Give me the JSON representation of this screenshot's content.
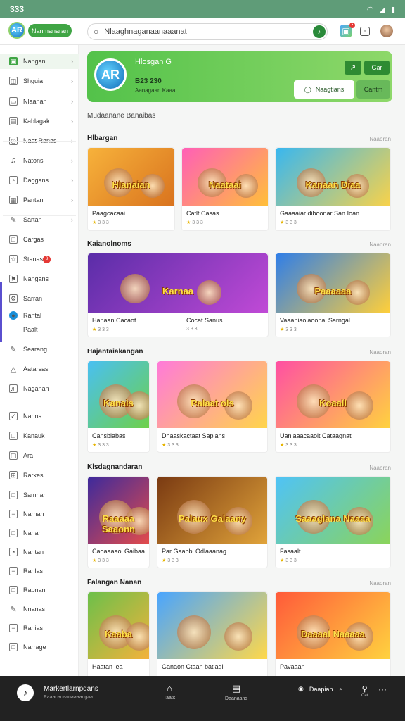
{
  "status": {
    "time": "333"
  },
  "header": {
    "logo_glyph": "AR",
    "brand": "Nanmanaran",
    "search_placeholder": "Nlaaghnaganaanaaanat",
    "mic_glyph": "♪"
  },
  "sidebar": {
    "items": [
      {
        "label": "Nangan",
        "icon": "home-icon"
      },
      {
        "label": "Shguia",
        "icon": "shorts-icon"
      },
      {
        "label": "Nlaanan",
        "icon": "subscriptions-icon"
      },
      {
        "label": "Kablagak",
        "icon": "library-icon"
      },
      {
        "label": "Naat Ranas",
        "icon": "history-icon"
      },
      {
        "label": "Natons",
        "icon": "bell-icon"
      },
      {
        "label": "Daggans",
        "icon": "clock-icon"
      },
      {
        "label": "Pantan",
        "icon": "film-icon"
      },
      {
        "label": "Sartan",
        "icon": "pencil-icon"
      },
      {
        "label": "Cargas",
        "icon": "box-icon"
      },
      {
        "label": "Stanas",
        "icon": "star-icon",
        "badge": "3"
      },
      {
        "label": "Nangans",
        "icon": "flag-icon"
      },
      {
        "label": "Sarran",
        "icon": "gear-icon"
      },
      {
        "label": "Rantal",
        "icon": "globe-icon"
      },
      {
        "label": "Paalt",
        "icon": "none"
      },
      {
        "label": "Searang",
        "icon": "pencil-icon"
      },
      {
        "label": "Aatarsas",
        "icon": "triangle-icon"
      },
      {
        "label": "Naganan",
        "icon": "music-icon"
      },
      {
        "label": "Nanns",
        "icon": "check-icon"
      },
      {
        "label": "Kanauk",
        "icon": "box-icon"
      },
      {
        "label": "Ara",
        "icon": "ticket-icon"
      },
      {
        "label": "Rarkes",
        "icon": "cart-icon"
      },
      {
        "label": "Samnan",
        "icon": "box-icon"
      },
      {
        "label": "Narnan",
        "icon": "list-icon"
      },
      {
        "label": "Nanan",
        "icon": "box-icon"
      },
      {
        "label": "Nantan",
        "icon": "clock-icon"
      },
      {
        "label": "Ranlas",
        "icon": "list-icon"
      },
      {
        "label": "Rapnan",
        "icon": "box-icon"
      },
      {
        "label": "Nnanas",
        "icon": "pencil-icon"
      },
      {
        "label": "Ranias",
        "icon": "list-icon"
      },
      {
        "label": "Narrage",
        "icon": "box-icon"
      }
    ]
  },
  "hero": {
    "title": "Hlosgan G",
    "sub1": "B23 230",
    "sub2": "Aanagaan Kaaa",
    "follow": "Naagtians",
    "join": "Cantm",
    "btn_small": "↗",
    "btn_dark": "Gar"
  },
  "description": "Mudaanane Banaibas",
  "sections": [
    {
      "title": "Hlbargan",
      "more": "Naaoran",
      "cards": [
        {
          "name": "Paagcacaai",
          "meta": "3 3 3",
          "thumb_text": "Hlanaian"
        },
        {
          "name": "Catlt Casas",
          "meta": "3 3 3",
          "thumb_text": "Naataai"
        },
        {
          "name": "Gaaaaiar diboonar San Ioan",
          "meta": "3 3 3",
          "thumb_text": "Kanaan Diaa"
        }
      ]
    },
    {
      "title": "Kaianolnoms",
      "more": "Naaoran",
      "cards": [
        {
          "name": "Hanaan Cacaot",
          "meta": "3 3 3",
          "thumb_text": "Karnaa"
        },
        {
          "name": "Cocat Sanus",
          "meta": "3 3 3",
          "thumb_text": ""
        },
        {
          "name": "Vaaaniaolaoonal Sarngal",
          "meta": "3 3 3",
          "thumb_text": "Paaaaaa"
        }
      ]
    },
    {
      "title": "Hajantaiakangan",
      "more": "Naaoran",
      "cards": [
        {
          "name": "Cansblabas",
          "meta": "3 3 3",
          "thumb_text": "Kanais"
        },
        {
          "name": "Dhaaskactaat Saplans",
          "meta": "3 3 3",
          "thumb_text": "Ralaat ols"
        },
        {
          "name": "Uanlaaacaaolt Cataagnat",
          "meta": "3 3 3",
          "thumb_text": "Koaall"
        }
      ]
    },
    {
      "title": "Klsdagnandaran",
      "more": "Naaoran",
      "cards": [
        {
          "name": "Caoaaaaol Gaibaa",
          "meta": "3 3 3",
          "thumb_text": "Raaaaa Saaonn"
        },
        {
          "name": "Par Gaabbl Odlaaanag",
          "meta": "3 3 3",
          "thumb_text": "Palaux Galaany"
        },
        {
          "name": "Fasaalt",
          "meta": "3 3 3",
          "thumb_text": "Saaaglana Naaaa"
        }
      ]
    },
    {
      "title": "Falangan Nanan",
      "more": "Naaoran",
      "cards": [
        {
          "name": "Haatan lea",
          "meta": "",
          "thumb_text": "Kaaba"
        },
        {
          "name": "Ganaon Ctaan batlagi",
          "meta": "",
          "thumb_text": ""
        },
        {
          "name": "Pavaaan",
          "meta": "",
          "thumb_text": "Daaaal Naaaaa"
        }
      ]
    }
  ],
  "bottom": {
    "app_glyph": "♪",
    "title": "Markertlarnpdans",
    "sub": "Paaacacaanaaaangaa",
    "tab1": "Taats",
    "tab2": "Daanaans",
    "right": "Daapian",
    "cast_label": "Cat",
    "more": "···"
  },
  "colors": {
    "accent": "#3fa544",
    "hero_start": "#53c24a",
    "hero_end": "#8ed86a",
    "status_bar": "#5f9c78",
    "bottom_bar": "#222222"
  }
}
